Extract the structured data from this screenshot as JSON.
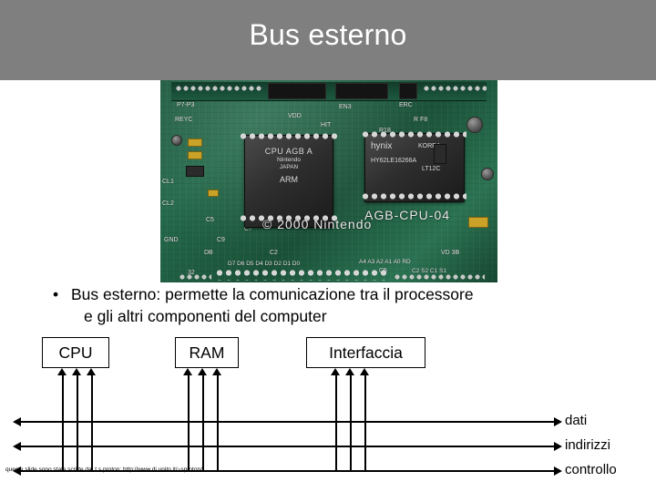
{
  "slide": {
    "title": "Bus esterno",
    "title_bar_color": "#7f7f7f",
    "bullet": {
      "marker": "•",
      "line1": "Bus esterno: permette la comunicazione tra il processore",
      "line2": "e gli altri componenti del computer"
    },
    "boxes": [
      {
        "label": "CPU"
      },
      {
        "label": "RAM"
      },
      {
        "label": "Interfaccia"
      }
    ],
    "bus_labels": [
      {
        "label": "dati"
      },
      {
        "label": "indirizzi"
      },
      {
        "label": "controllo"
      }
    ],
    "footnote": "queste slide sono state scritte da .t.s proton: http://www.di.unito.it/~sproton/"
  },
  "photo": {
    "alt_name": "gameboy-advance-mainboard-photo",
    "silkscreen": [
      {
        "text": "P7-P3"
      },
      {
        "text": "ERC"
      },
      {
        "text": "REYC"
      },
      {
        "text": "EN3"
      },
      {
        "text": "R F8"
      },
      {
        "text": "VDD"
      },
      {
        "text": "HIT"
      },
      {
        "text": "R18"
      },
      {
        "text": "CL1"
      },
      {
        "text": "CL2"
      },
      {
        "text": "GND"
      },
      {
        "text": "C5"
      },
      {
        "text": "C9"
      },
      {
        "text": "C7"
      },
      {
        "text": "DB"
      },
      {
        "text": "C2"
      },
      {
        "text": "D7 D6 D5 D4 D3 D2 D1 D0"
      },
      {
        "text": "A4  A3  A2  A1  A0  RD"
      },
      {
        "text": "VD  3B"
      },
      {
        "text": "C2  S2  C1  S1"
      },
      {
        "text": "32"
      },
      {
        "text": "C5"
      }
    ],
    "chips": [
      {
        "name": "cpu-chip",
        "lines": [
          "CPU AGB A",
          "Nintendo",
          "JAPAN",
          "ARM"
        ]
      },
      {
        "name": "ram-chip",
        "lines": [
          "hynix",
          "KOREA",
          "HY62LE16266A",
          "LT12C"
        ]
      },
      {
        "name": "copyright-text",
        "lines": [
          "© 2000 Nintendo"
        ]
      },
      {
        "name": "board-label",
        "lines": [
          "AGB-CPU-04"
        ]
      }
    ]
  }
}
